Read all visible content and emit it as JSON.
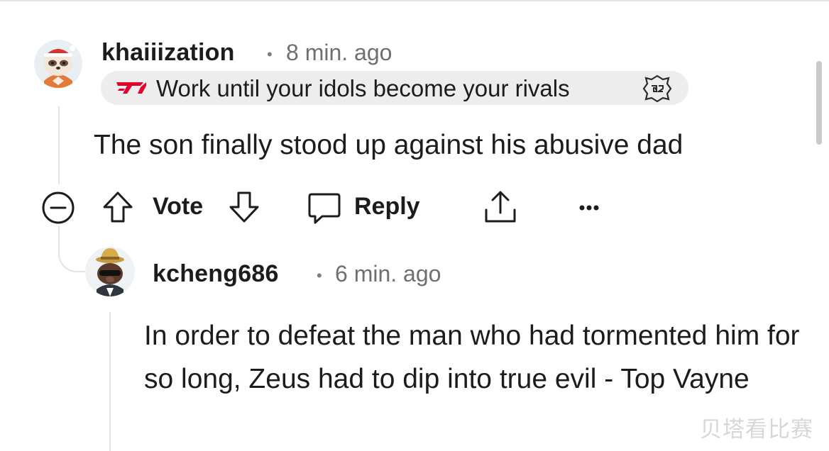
{
  "comment": {
    "username": "khaiiization",
    "time": "8 min. ago",
    "flair": {
      "text": "Work until your idols become your rivals",
      "left_icon": "t1-logo-icon",
      "right_icon": "g2-logo-icon"
    },
    "body": "The son finally stood up against his abusive dad",
    "actions": {
      "vote_label": "Vote",
      "reply_label": "Reply",
      "more_label": "•••"
    }
  },
  "reply": {
    "username": "kcheng686",
    "time": "6 min. ago",
    "body": "In order to defeat the man who had tormented him for so long, Zeus had to dip into true evil - Top Vayne"
  },
  "separator": "•",
  "watermark": "贝塔看比赛",
  "colors": {
    "text": "#1c1c1c",
    "meta": "#6f6f6f",
    "flair_bg": "#ededed",
    "thread_line": "#e3e3e3",
    "t1_red": "#e2012d"
  }
}
